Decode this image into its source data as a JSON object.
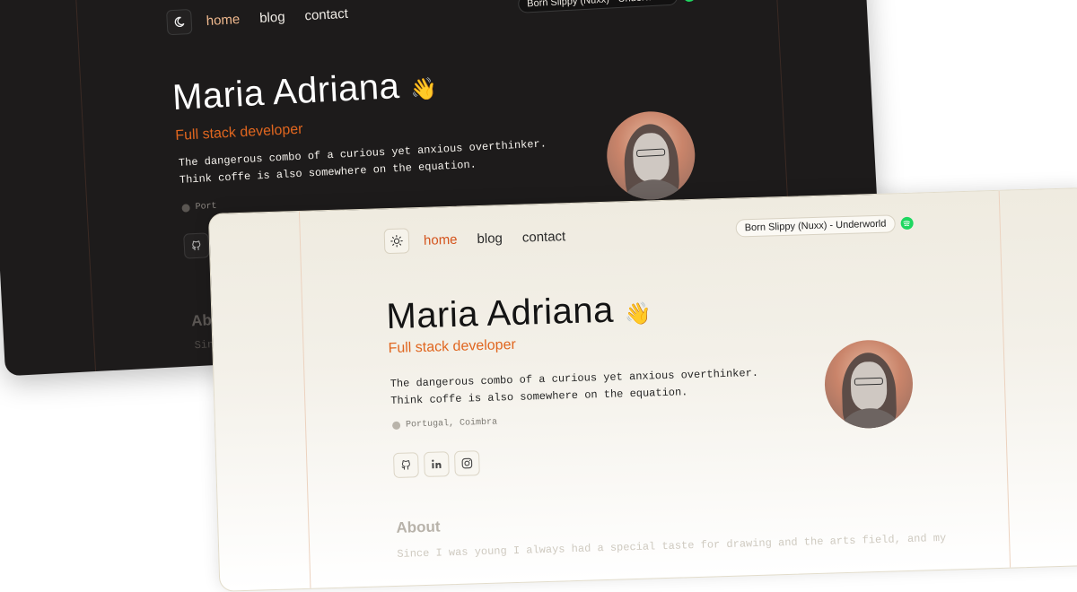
{
  "nav": {
    "items": [
      "home",
      "blog",
      "contact"
    ]
  },
  "now_playing": {
    "track": "Born Slippy (Nuxx) - Underworld",
    "service_icon": "spotify-icon",
    "service_color": "#1ed760"
  },
  "profile": {
    "name": "Maria Adriana",
    "emoji": "👋",
    "role": "Full stack developer",
    "bio_line1": "The dangerous combo of a curious yet anxious overthinker.",
    "bio_line2": "Think coffe is also somewhere on the equation.",
    "location": "Portugal, Coimbra",
    "location_truncated": "Port",
    "socials": [
      "github-icon",
      "linkedin-icon",
      "instagram-icon"
    ]
  },
  "about": {
    "heading": "About",
    "heading_truncated": "Abo",
    "text": "Since I was young I always had a special taste for drawing and the arts field, and my",
    "text_truncated": "Since"
  },
  "colors": {
    "accent": "#d4541d",
    "dark_accent": "#f0b98e",
    "dark_bg": "#1d1b1b",
    "light_bg": "#efebe0"
  }
}
